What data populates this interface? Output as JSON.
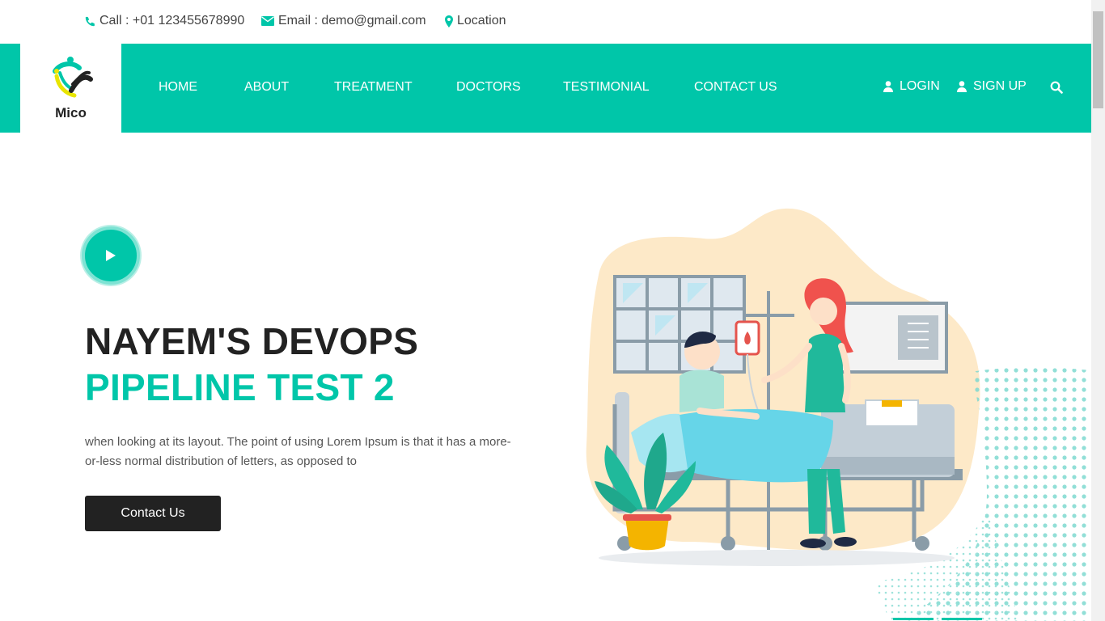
{
  "topbar": {
    "call": "Call : +01 123455678990",
    "email": "Email : demo@gmail.com",
    "location": "Location"
  },
  "brand": {
    "name": "Mico"
  },
  "nav": {
    "items": [
      {
        "label": "HOME"
      },
      {
        "label": "ABOUT"
      },
      {
        "label": "TREATMENT"
      },
      {
        "label": "DOCTORS"
      },
      {
        "label": "TESTIMONIAL"
      },
      {
        "label": "CONTACT US"
      }
    ],
    "login": "LOGIN",
    "signup": "SIGN UP"
  },
  "hero": {
    "title_line1": "NAYEM'S DEVOPS",
    "title_line2": "PIPELINE TEST 2",
    "description": "when looking at its layout. The point of using Lorem Ipsum is that it has a more-or-less normal distribution of letters, as opposed to",
    "cta_label": "Contact Us"
  },
  "colors": {
    "accent": "#00c6a9",
    "dark": "#222222",
    "text": "#555555"
  },
  "icons": [
    "phone-icon",
    "envelope-icon",
    "map-marker-icon",
    "user-icon",
    "search-icon",
    "play-icon"
  ]
}
